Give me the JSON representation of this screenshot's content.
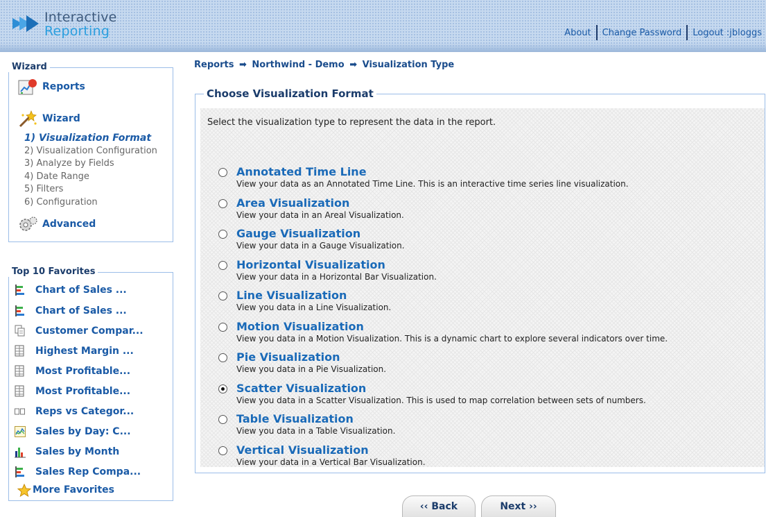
{
  "header": {
    "logo_line1": "Interactive",
    "logo_line2": "Reporting",
    "links": [
      "About",
      "Change Password",
      "Logout :jbloggs"
    ]
  },
  "wizard_panel": {
    "legend": "Wizard",
    "reports_label": "Reports",
    "wizard_label": "Wizard",
    "steps": [
      "1) Visualization Format",
      "2) Visualization Configuration",
      "3) Analyze by Fields",
      "4) Date Range",
      "5) Filters",
      "6) Configuration"
    ],
    "advanced_label": "Advanced"
  },
  "favorites_panel": {
    "legend": "Top 10 Favorites",
    "items": [
      {
        "label": "Chart of Sales ...",
        "icon": "bar-chart-icon"
      },
      {
        "label": "Chart of Sales ...",
        "icon": "bar-chart-icon"
      },
      {
        "label": "Customer Compar...",
        "icon": "document-copy-icon"
      },
      {
        "label": "Highest Margin ...",
        "icon": "table-icon"
      },
      {
        "label": "Most Profitable...",
        "icon": "table-icon"
      },
      {
        "label": "Most Profitable...",
        "icon": "table-icon"
      },
      {
        "label": "Reps vs Categor...",
        "icon": "pivot-icon"
      },
      {
        "label": "Sales by Day: C...",
        "icon": "line-chart-icon"
      },
      {
        "label": "Sales by Month",
        "icon": "column-chart-icon"
      },
      {
        "label": "Sales Rep Compa...",
        "icon": "bar-chart-icon"
      }
    ],
    "more_label": "More Favorites"
  },
  "breadcrumb": {
    "items": [
      "Reports",
      "Northwind - Demo",
      "Visualization Type"
    ],
    "arrow": "➡"
  },
  "main": {
    "legend": "Choose Visualization Format",
    "intro": "Select the visualization type to represent the data in the report.",
    "selected_option": "Scatter Visualization",
    "options": [
      {
        "title": "Annotated Time Line",
        "desc": "View your data as an Annotated Time Line. This is an interactive time series line visualization."
      },
      {
        "title": "Area Visualization",
        "desc": "View your data in an Areal Visualization."
      },
      {
        "title": "Gauge Visualization",
        "desc": "View your data in a Gauge Visualization."
      },
      {
        "title": "Horizontal Visualization",
        "desc": "View your data in a Horizontal Bar Visualization."
      },
      {
        "title": "Line Visualization",
        "desc": "View you data in a Line Visualization."
      },
      {
        "title": "Motion Visualization",
        "desc": "View you data in a Motion Visualization. This is a dynamic chart to explore several indicators over time."
      },
      {
        "title": "Pie Visualization",
        "desc": "View you data in a Pie Visualization."
      },
      {
        "title": "Scatter Visualization",
        "desc": "View you data in a Scatter Visualization. This is used to map correlation between sets of numbers."
      },
      {
        "title": "Table Visualization",
        "desc": "View you data in a Table Visualization."
      },
      {
        "title": "Vertical Visualization",
        "desc": "View your data in a Vertical Bar Visualization."
      }
    ]
  },
  "buttons": {
    "back": "‹‹ Back",
    "next": "Next ››"
  }
}
